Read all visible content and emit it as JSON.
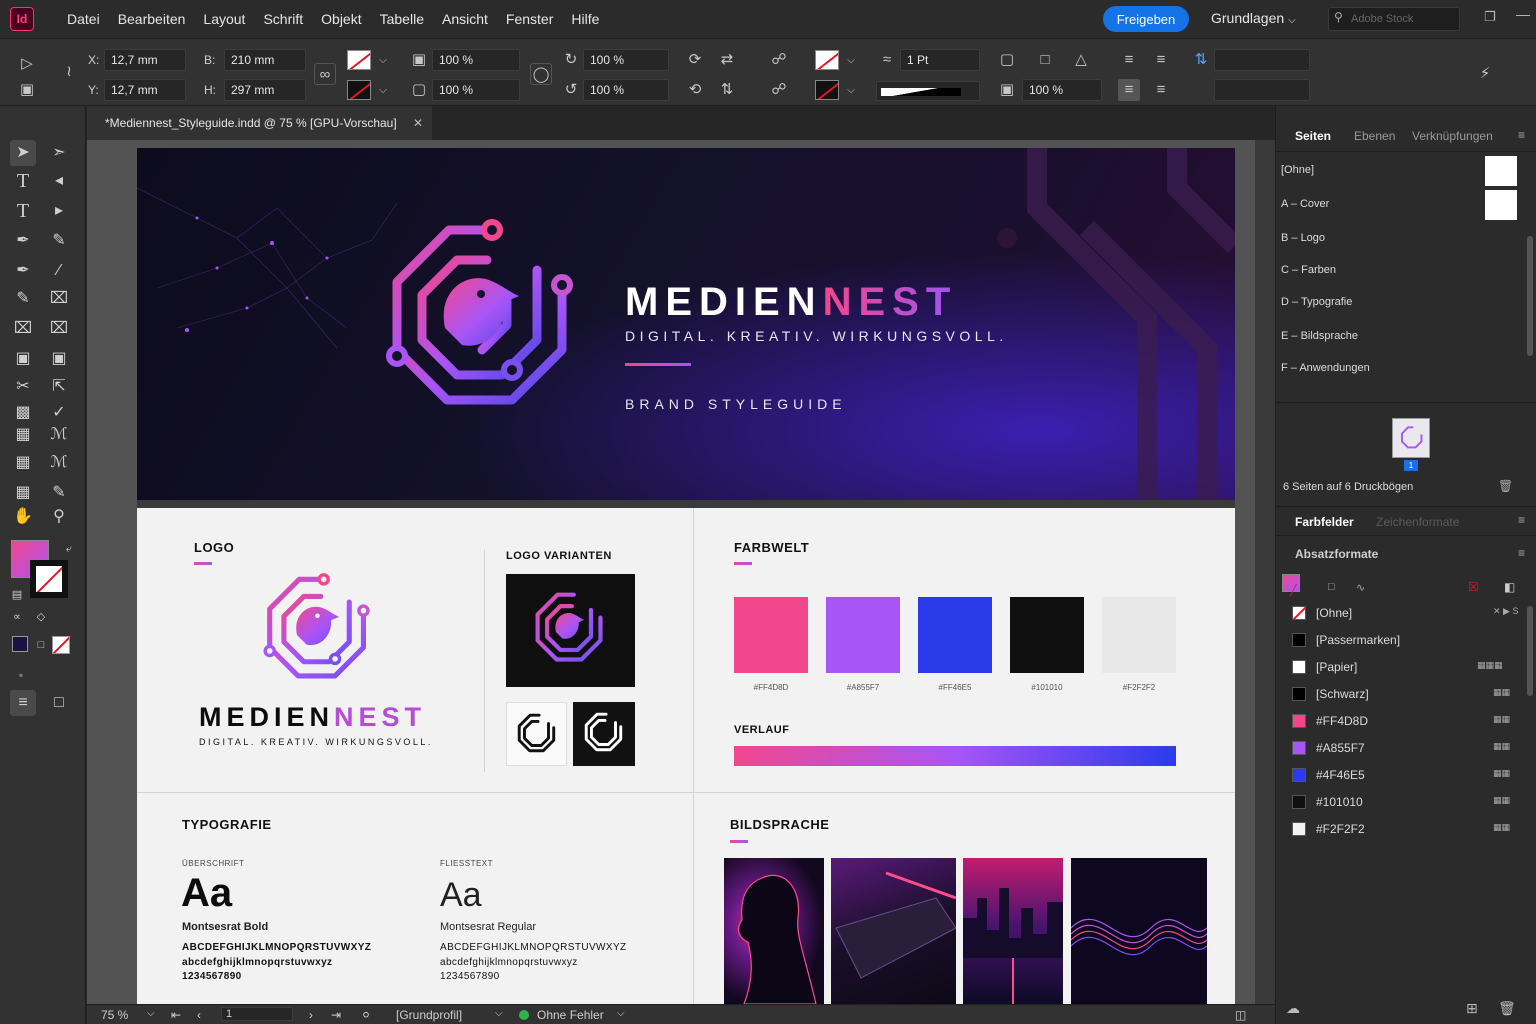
{
  "app": {
    "logo_text": "Id",
    "menu": [
      "Datei",
      "Bearbeiten",
      "Layout",
      "Schrift",
      "Objekt",
      "Tabelle",
      "Ansicht",
      "Fenster",
      "Hilfe"
    ],
    "share_label": "Freigeben",
    "workspace_label": "Grundlagen",
    "stock_placeholder": "Adobe Stock"
  },
  "control": {
    "x_label": "X:",
    "x_value": "12,7 mm",
    "y_label": "Y:",
    "y_value": "12,7 mm",
    "w_label": "B:",
    "w_value": "210 mm",
    "h_label": "H:",
    "h_value": "297 mm",
    "scale_x": "100 %",
    "scale_y": "100 %",
    "scale_x2": "100 %",
    "scale_y2": "100 %",
    "stroke_weight": "1 Pt",
    "opacity": "100 %"
  },
  "document": {
    "tab_title": "*Mediennest_Styleguide.indd @ 75 % [GPU-Vorschau]"
  },
  "cover": {
    "brand_part1": "MEDIEN",
    "brand_part2": "NEST",
    "tagline": "DIGITAL. KREATIV. WIRKUNGSVOLL.",
    "subtitle": "BRAND STYLEGUIDE"
  },
  "logo_section": {
    "title": "LOGO",
    "brand_part1": "MEDIEN",
    "brand_part2": "NEST",
    "tagline": "DIGITAL. KREATIV. WIRKUNGSVOLL.",
    "variants_title": "LOGO VARIANTEN"
  },
  "colors_section": {
    "title": "FARBWELT",
    "swatches": [
      {
        "hex": "#F2478D",
        "label": "#FF4D8D"
      },
      {
        "hex": "#A855F7",
        "label": "#A855F7"
      },
      {
        "hex": "#2B3BEA",
        "label": "#FF46E5"
      },
      {
        "hex": "#101010",
        "label": "#101010"
      },
      {
        "hex": "#F2F2F2",
        "label": "#F2F2F2"
      }
    ],
    "gradient_title": "VERLAUF"
  },
  "typo_section": {
    "title": "TYPOGRAFIE",
    "heading_label": "ÜBERSCHRIFT",
    "heading_sample": "Aa",
    "heading_font": "Montsesrat Bold",
    "heading_upper": "ABCDEFGHIJKLMNOPQRSTUVWXYZ",
    "heading_lower": "abcdefghijklmnopqrstuvwxyz",
    "heading_digits": "1234567890",
    "body_label": "FLIESSTEXT",
    "body_sample": "Aa",
    "body_font": "Montsesrat Regular",
    "body_upper": "ABCDEFGHIJKLMNOPQRSTUVWXYZ",
    "body_lower": "abcdefghijklmnopqrstuvwxyz",
    "body_digits": "1234567890"
  },
  "imagery_section": {
    "title": "BILDSPRACHE"
  },
  "status": {
    "zoom": "75 %",
    "page": "1",
    "profile": "[Grundprofil]",
    "preflight": "Ohne Fehler"
  },
  "pages_panel": {
    "tabs": [
      "Seiten",
      "Ebenen",
      "Verknüpfungen"
    ],
    "masters": [
      "[Ohne]",
      "A – Cover",
      "B – Logo",
      "C – Farben",
      "D – Typografie",
      "E – Bildsprache",
      "F – Anwendungen"
    ],
    "page_number": "1",
    "summary": "6 Seiten auf 6 Druckbögen"
  },
  "swatches_panel": {
    "tabs": [
      "Farbfelder",
      "Zeichenformate"
    ],
    "tab2": "Absatzformate",
    "items": [
      {
        "name": "[Ohne]",
        "color": "none"
      },
      {
        "name": "[Passermarken]",
        "color": "#000000"
      },
      {
        "name": "[Papier]",
        "color": "#ffffff"
      },
      {
        "name": "[Schwarz]",
        "color": "#000000"
      },
      {
        "name": "#FF4D8D",
        "color": "#F2478D"
      },
      {
        "name": "#A855F7",
        "color": "#A855F7"
      },
      {
        "name": "#4F46E5",
        "color": "#2B3BEA"
      },
      {
        "name": "#101010",
        "color": "#101010"
      },
      {
        "name": "#F2F2F2",
        "color": "#F2F2F2"
      }
    ]
  }
}
